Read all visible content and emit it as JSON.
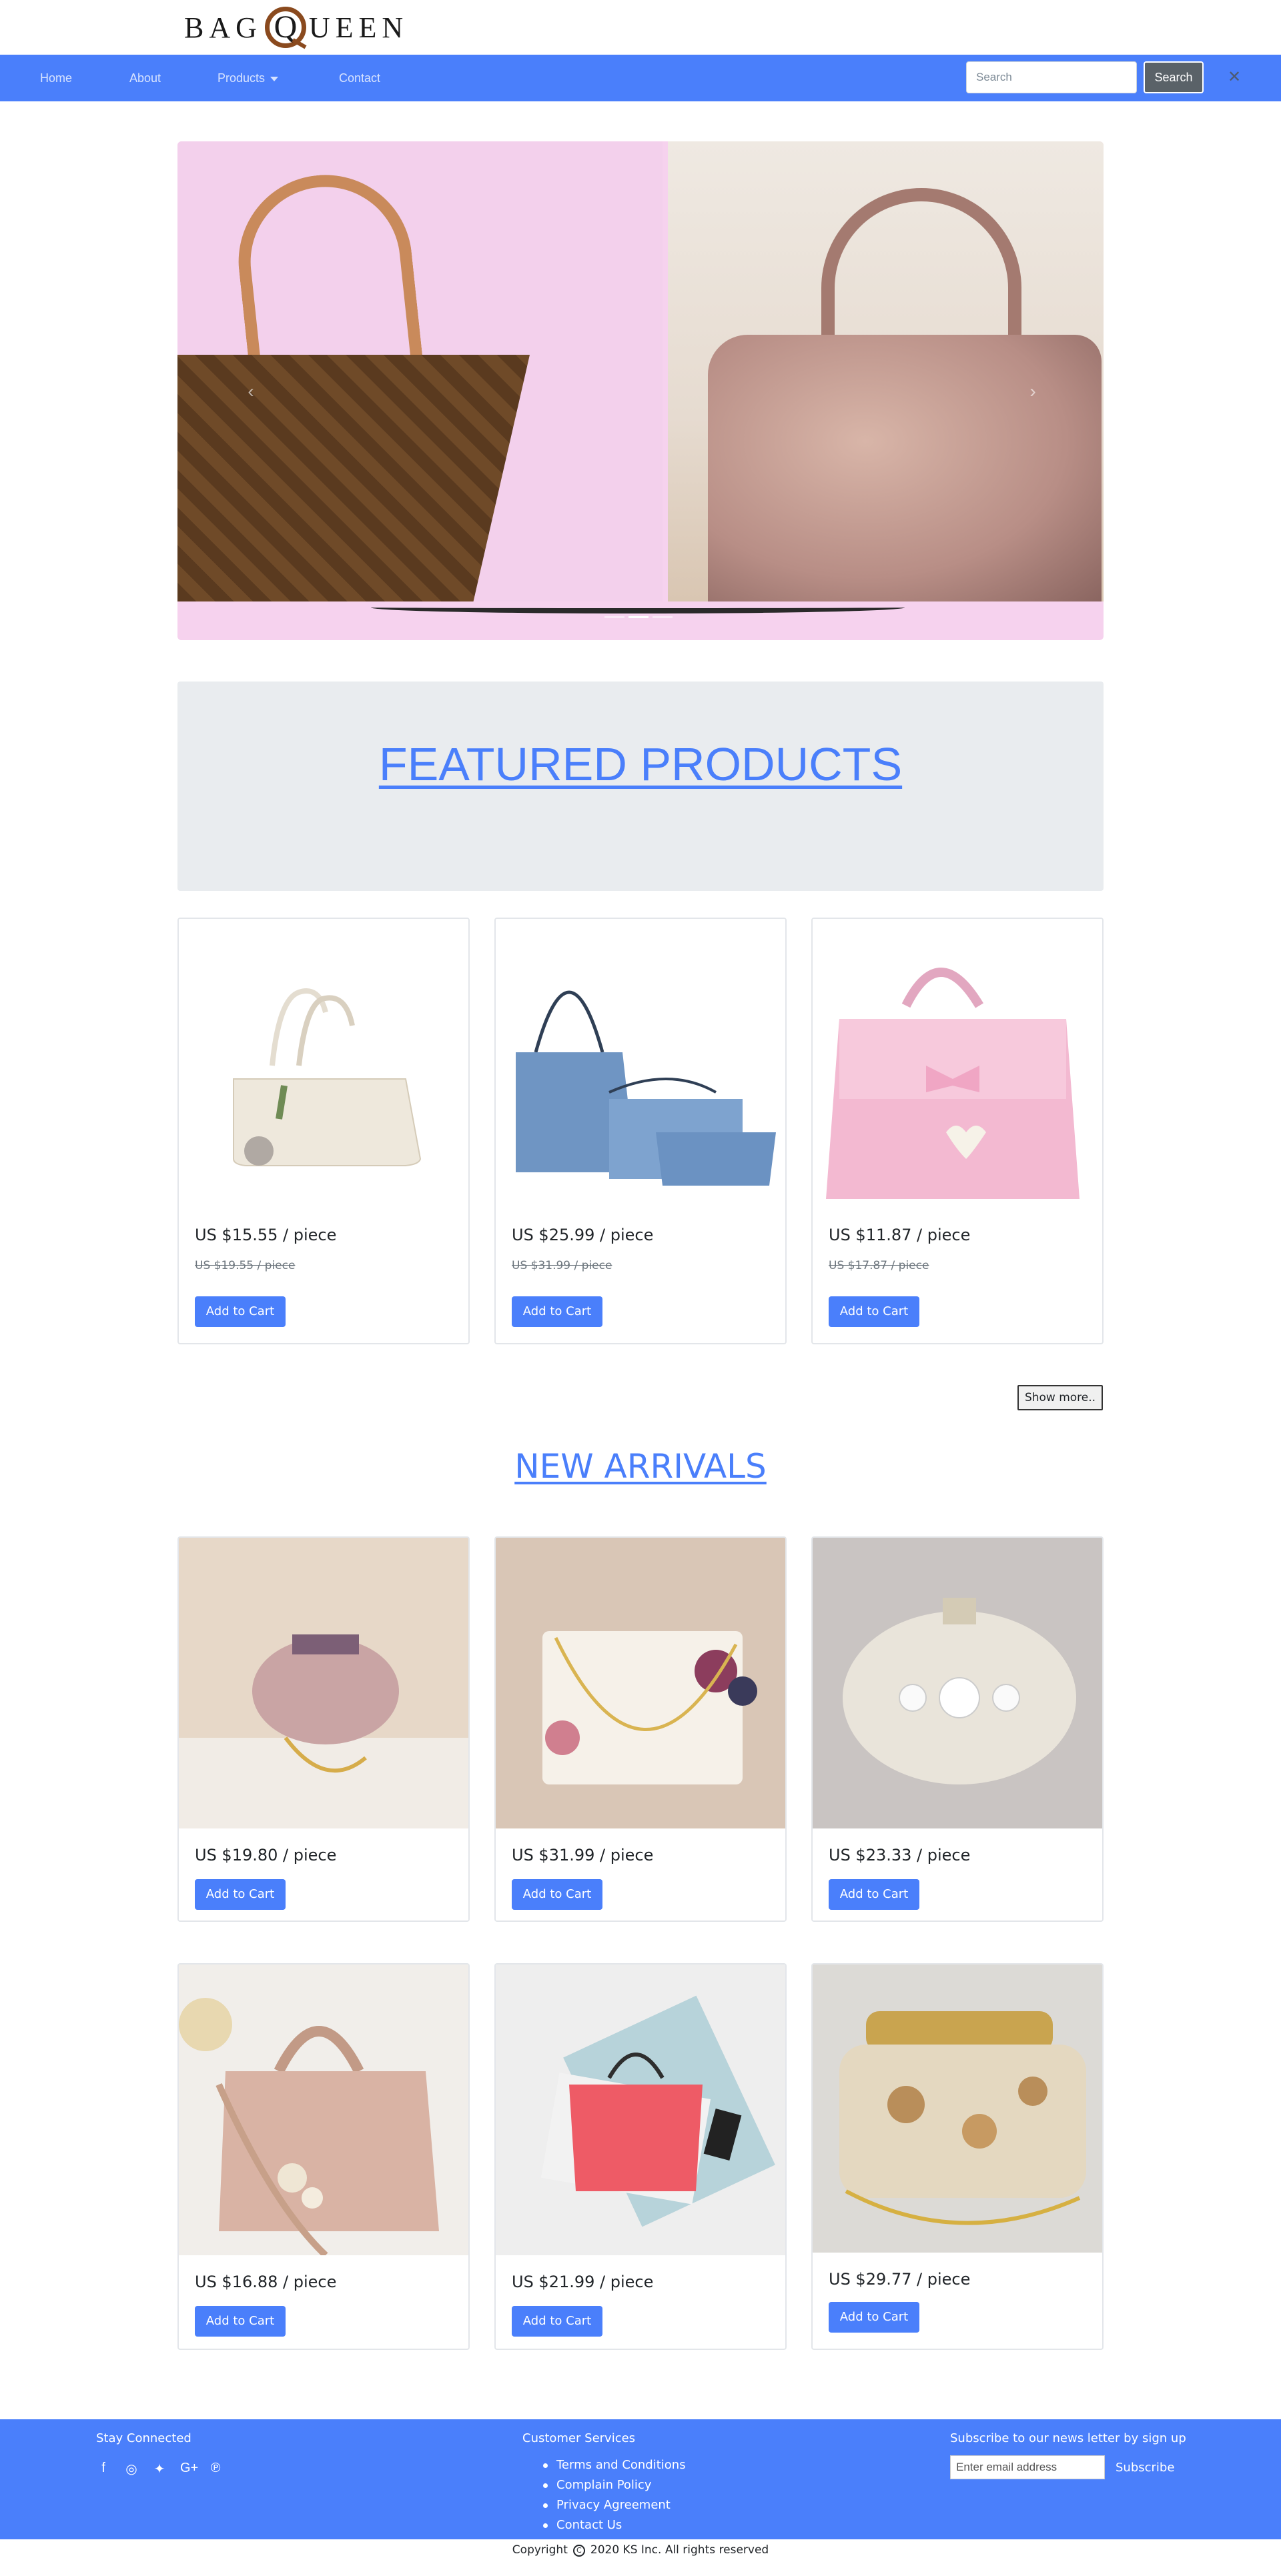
{
  "logo": {
    "text_before": "BAG",
    "q_letter": "Q",
    "text_after": "UEEN"
  },
  "navbar": {
    "links": [
      "Home",
      "About",
      "Products",
      "Contact"
    ],
    "search": {
      "placeholder": "Search",
      "button_label": "Search"
    },
    "close_icon": "close-icon"
  },
  "featured": {
    "title": "FEATURED PRODUCTS",
    "products": [
      {
        "price": "US $15.55 / piece",
        "old_price": "US $19.55 / piece",
        "button": "Add to Cart"
      },
      {
        "price": "US $25.99 / piece",
        "old_price": "US $31.99 / piece",
        "button": "Add to Cart"
      },
      {
        "price": "US $11.87 / piece",
        "old_price": "US $17.87 / piece",
        "button": "Add to Cart"
      }
    ],
    "show_more": "Show more.."
  },
  "new_arrivals": {
    "title": "NEW ARRIVALS",
    "products": [
      {
        "price": "US $19.80 / piece",
        "button": "Add to Cart"
      },
      {
        "price": "US $31.99 / piece",
        "button": "Add to Cart"
      },
      {
        "price": "US $23.33 / piece",
        "button": "Add to Cart"
      },
      {
        "price": "US $16.88 / piece",
        "button": "Add to Cart"
      },
      {
        "price": "US $21.99 / piece",
        "button": "Add to Cart"
      },
      {
        "price": "US $29.77 / piece",
        "button": "Add to Cart"
      }
    ]
  },
  "footer": {
    "stay_connected": "Stay Connected",
    "social_icons": [
      "facebook-icon",
      "instagram-icon",
      "twitter-icon",
      "google-plus-icon",
      "pinterest-icon"
    ],
    "customer_services": "Customer Services",
    "links": [
      "Terms and Conditions",
      "Complain Policy",
      "Privacy Agreement",
      "Contact Us"
    ],
    "newsletter": "Subscribe to our news letter by sign up",
    "email_placeholder": "Enter email address",
    "subscribe": "Subscribe",
    "copyright_before": "Copyright",
    "copyright_after": "2020 KS Inc. All rights reserved"
  },
  "colors": {
    "primary": "#4a7ffb",
    "banner_bg": "#e9ecef",
    "search_button": "#5a6268"
  }
}
